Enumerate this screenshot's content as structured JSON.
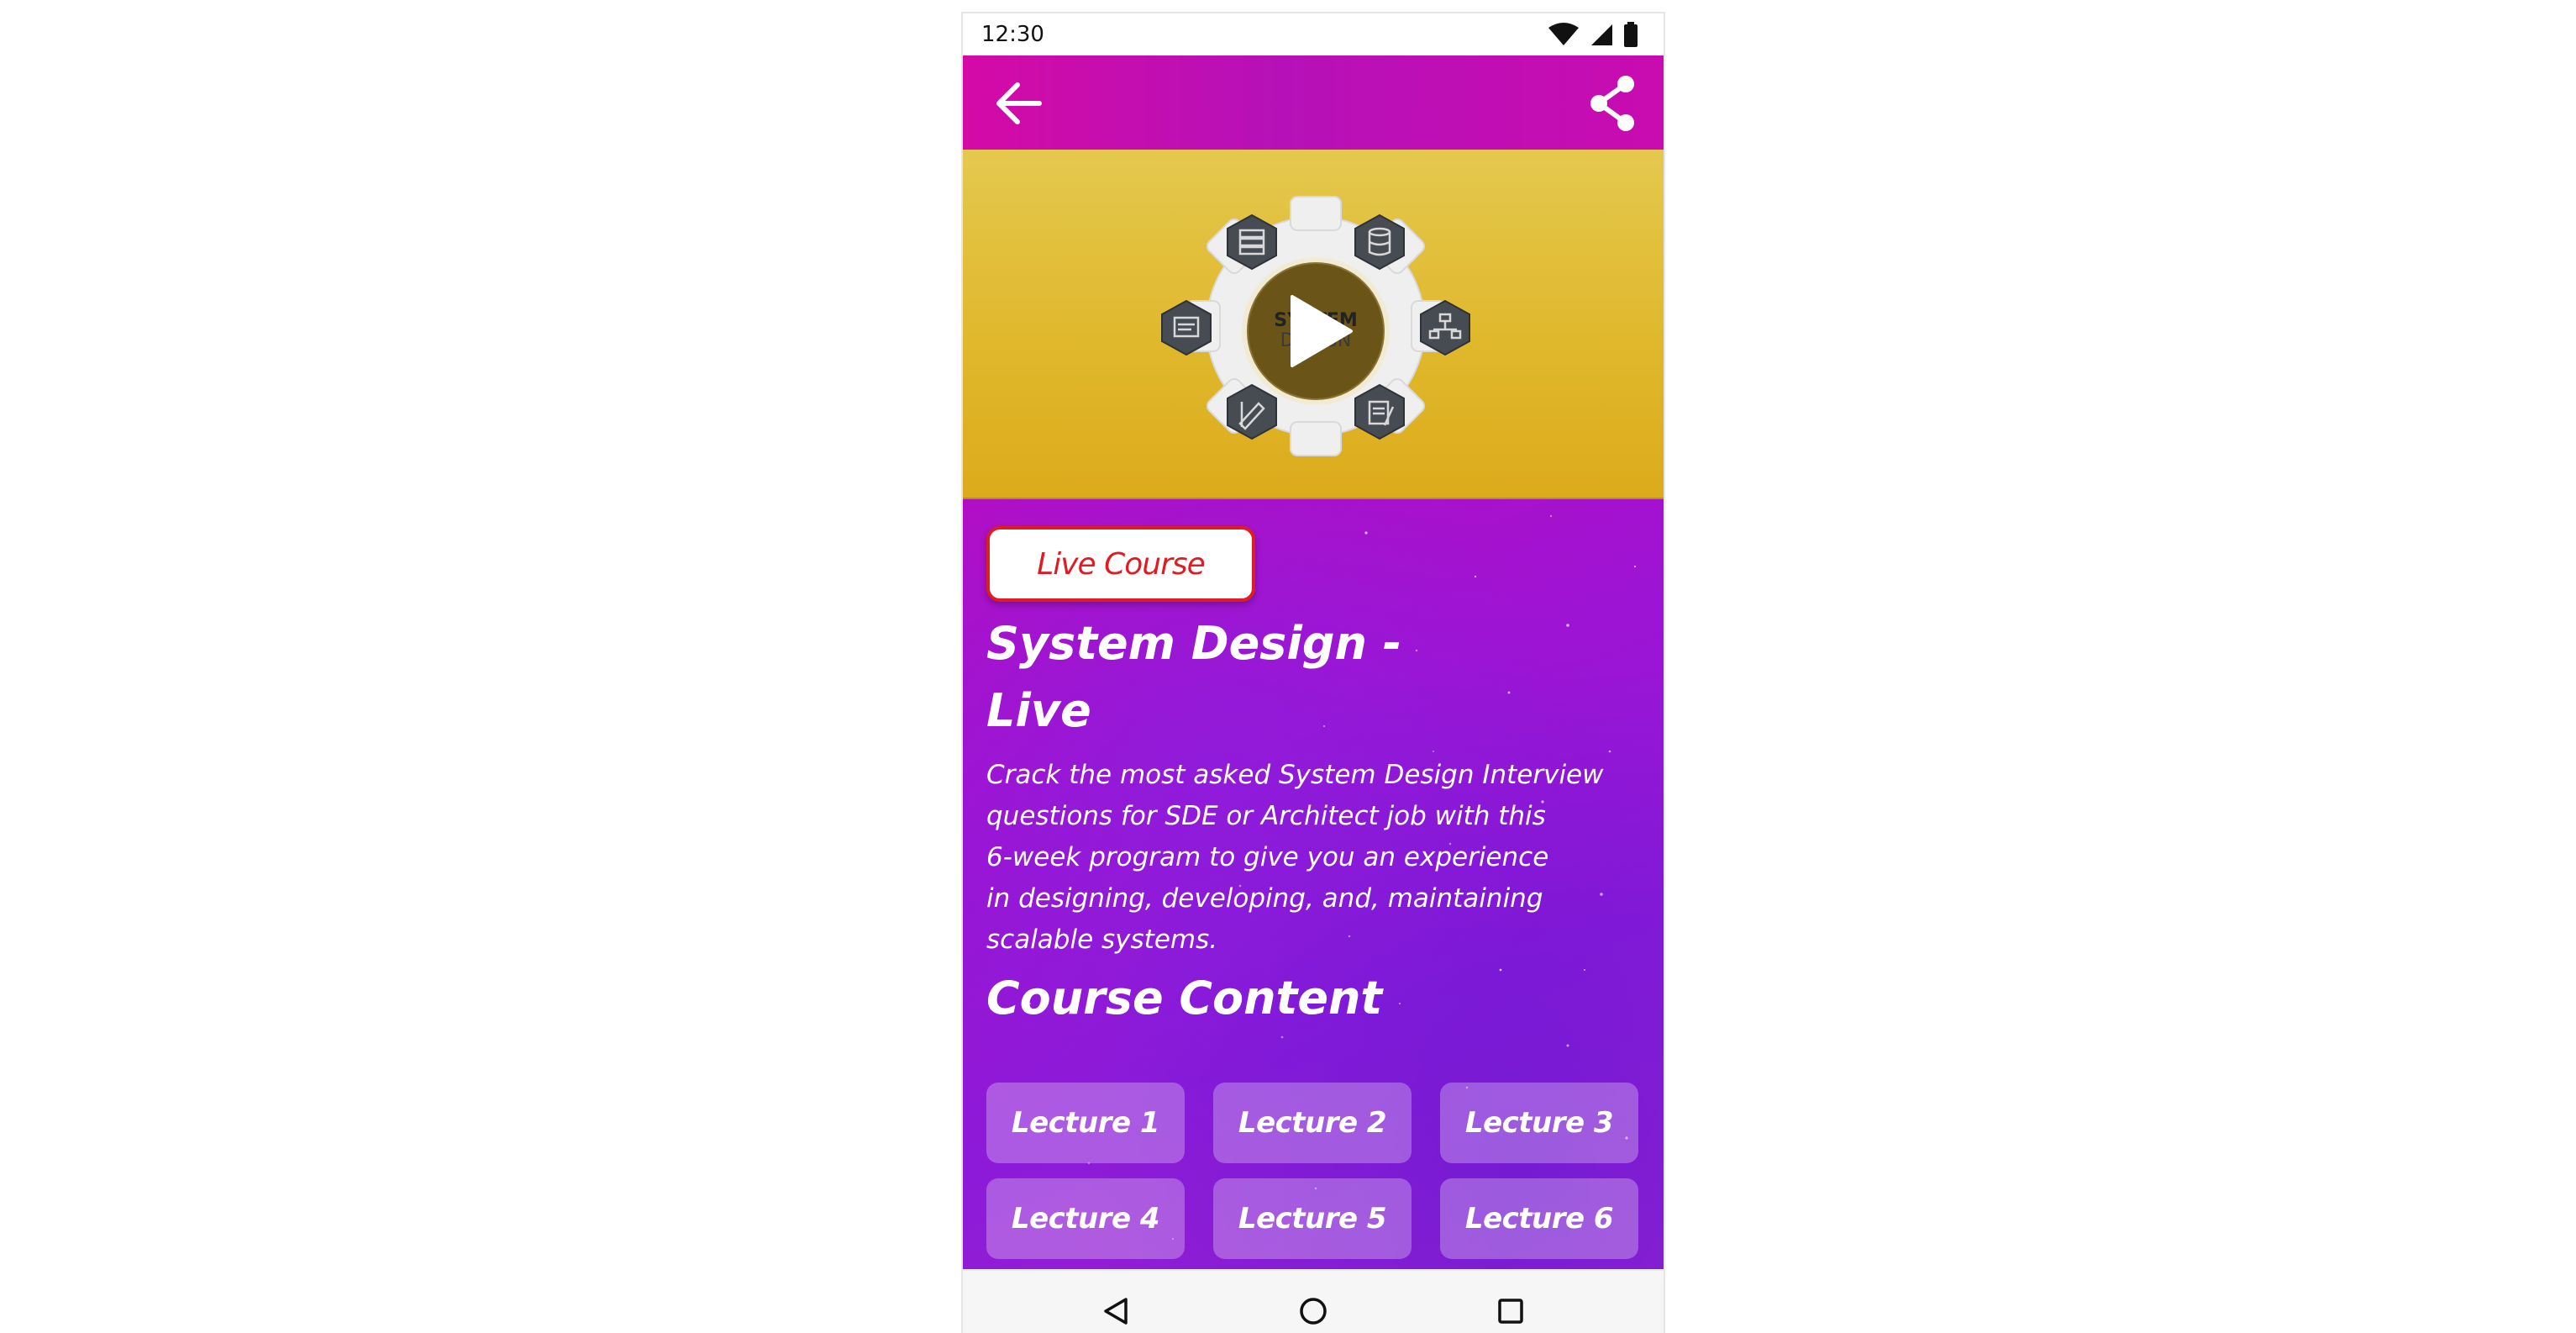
{
  "status_bar": {
    "time": "12:30",
    "icons": [
      "wifi-icon",
      "signal-icon",
      "battery-icon"
    ]
  },
  "app_bar": {
    "back_icon": "arrow-left-icon",
    "share_icon": "share-icon"
  },
  "video": {
    "thumbnail_text_line1": "SYSTEM",
    "thumbnail_text_line2": "DESIGN",
    "play_icon": "play-icon"
  },
  "course": {
    "badge": "Live Course",
    "title_line1": "System Design -",
    "title_line2": "Live",
    "description_lines": [
      "Crack the most asked System Design Interview",
      "questions for SDE or Architect job with this",
      "6-week program to give you an experience",
      "in designing, developing, and, maintaining",
      "scalable systems."
    ]
  },
  "content_section": {
    "heading": "Course Content",
    "lectures": [
      "Lecture 1",
      "Lecture 2",
      "Lecture 3",
      "Lecture 4",
      "Lecture 5",
      "Lecture 6"
    ]
  },
  "nav_bar": {
    "icons": [
      "nav-back-icon",
      "nav-home-icon",
      "nav-recents-icon"
    ]
  },
  "colors": {
    "app_bar": "#c80cb0",
    "video_bg": "#e0b82c",
    "content_bg": "#9d14d4",
    "badge_red": "#e11b22"
  }
}
